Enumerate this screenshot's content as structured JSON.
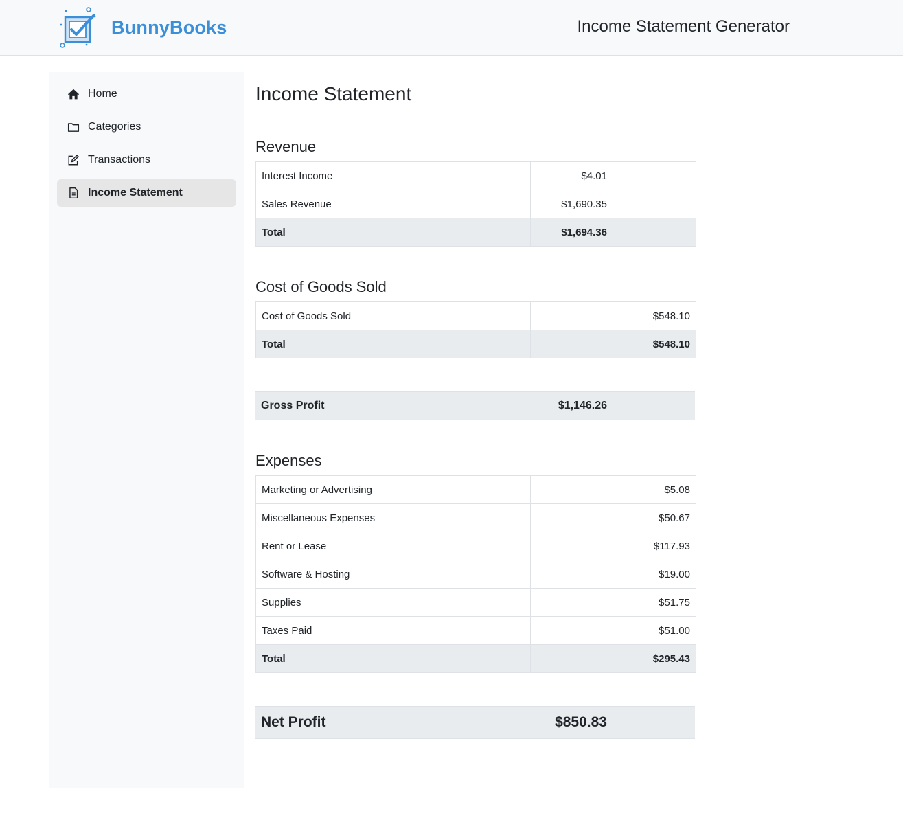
{
  "header": {
    "brand": "BunnyBooks",
    "app_title": "Income Statement Generator",
    "brand_color": "#3b8fd8"
  },
  "sidebar": {
    "items": [
      {
        "label": "Home",
        "icon": "home-icon"
      },
      {
        "label": "Categories",
        "icon": "folder-icon"
      },
      {
        "label": "Transactions",
        "icon": "edit-icon"
      },
      {
        "label": "Income Statement",
        "icon": "document-icon",
        "active": true
      }
    ]
  },
  "main": {
    "title": "Income Statement",
    "revenue": {
      "heading": "Revenue",
      "rows": [
        {
          "name": "Interest Income",
          "amount": "$4.01"
        },
        {
          "name": "Sales Revenue",
          "amount": "$1,690.35"
        }
      ],
      "total_label": "Total",
      "total": "$1,694.36"
    },
    "cogs": {
      "heading": "Cost of Goods Sold",
      "rows": [
        {
          "name": "Cost of Goods Sold",
          "amount": "$548.10"
        }
      ],
      "total_label": "Total",
      "total": "$548.10"
    },
    "gross_profit": {
      "label": "Gross Profit",
      "value": "$1,146.26"
    },
    "expenses": {
      "heading": "Expenses",
      "rows": [
        {
          "name": "Marketing or Advertising",
          "amount": "$5.08"
        },
        {
          "name": "Miscellaneous Expenses",
          "amount": "$50.67"
        },
        {
          "name": "Rent or Lease",
          "amount": "$117.93"
        },
        {
          "name": "Software & Hosting",
          "amount": "$19.00"
        },
        {
          "name": "Supplies",
          "amount": "$51.75"
        },
        {
          "name": "Taxes Paid",
          "amount": "$51.00"
        }
      ],
      "total_label": "Total",
      "total": "$295.43"
    },
    "net_profit": {
      "label": "Net Profit",
      "value": "$850.83"
    }
  }
}
